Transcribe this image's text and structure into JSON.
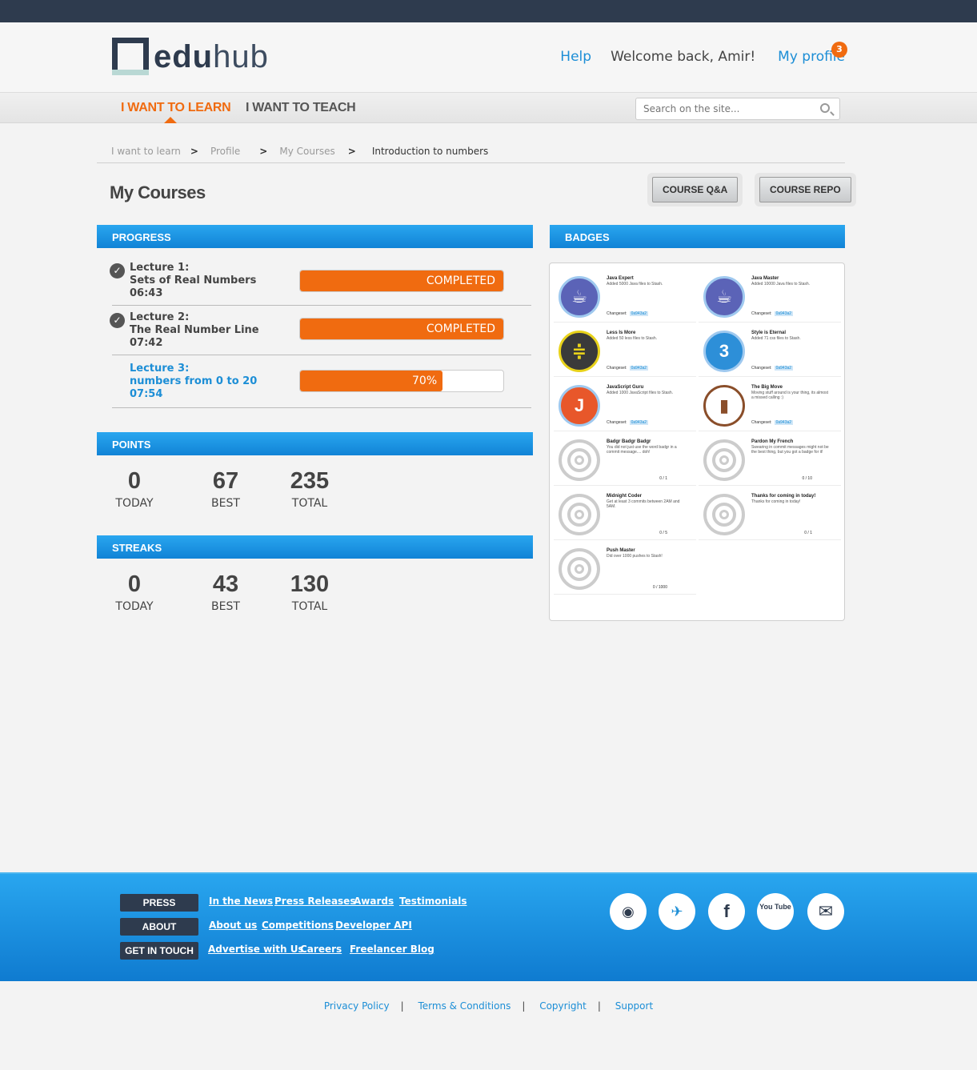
{
  "logo": {
    "bold": "edu",
    "light": "hub"
  },
  "header": {
    "help": "Help",
    "welcome": "Welcome back, Amir!",
    "profile": "My profile",
    "notifications": "3"
  },
  "nav": {
    "learn": "I WANT TO LEARN",
    "teach": "I WANT TO TEACH"
  },
  "search": {
    "placeholder": "Search on the site..."
  },
  "breadcrumb": [
    "I want to learn",
    "Profile",
    "My Courses",
    "Introduction to numbers"
  ],
  "page_title": "My Courses",
  "buttons": {
    "qa": "COURSE Q&A",
    "repo": "COURSE REPO"
  },
  "progress": {
    "title": "PROGRESS",
    "lectures": [
      {
        "line1": "Lecture 1:",
        "line2": "Sets of Real Numbers",
        "line3": "06:43",
        "status": "COMPLETED",
        "percent": 100
      },
      {
        "line1": "Lecture 2:",
        "line2": "The Real Number Line",
        "line3": "07:42",
        "status": "COMPLETED",
        "percent": 100
      },
      {
        "line1": "Lecture 3:",
        "line2": "numbers from 0 to 20",
        "line3": "07:54",
        "status": "70%",
        "percent": 70
      }
    ]
  },
  "points": {
    "title": "POINTS",
    "today": "0",
    "best": "67",
    "total": "235",
    "today_label": "TODAY",
    "best_label": "BEST",
    "total_label": "TOTAL"
  },
  "streaks": {
    "title": "STREAKS",
    "today": "0",
    "best": "43",
    "total": "130",
    "today_label": "TODAY",
    "best_label": "BEST",
    "total_label": "TOTAL"
  },
  "badges": {
    "title": "BADGES",
    "changeset_label": "Changeset:",
    "changeset_value": "0a943a2",
    "items": [
      {
        "name": "Java Expert",
        "desc": "Added 5000 Java files to Stash.",
        "earned": true,
        "color": "#5b63b7",
        "icon": "coffee-cup-icon",
        "glyph": "☕"
      },
      {
        "name": "Java Master",
        "desc": "Added 10000 Java files to Stash.",
        "earned": true,
        "color": "#5b63b7",
        "icon": "coffee-cup-icon",
        "glyph": "☕"
      },
      {
        "name": "Less Is More",
        "desc": "Added 50 less files to Stash.",
        "earned": true,
        "color": "#3a3a3a",
        "icon": "less-icon",
        "glyph": "≑"
      },
      {
        "name": "Style is Eternal",
        "desc": "Added 71 css files to Stash.",
        "earned": true,
        "color": "#2d8fd8",
        "icon": "css3-icon",
        "glyph": "3"
      },
      {
        "name": "JavaScript Guru",
        "desc": "Added 1000 JavaScript files to Stash.",
        "earned": true,
        "color": "#e8572a",
        "icon": "javascript-icon",
        "glyph": "J"
      },
      {
        "name": "The Big Move",
        "desc": "Moving stuff around is your thing, its almost a missed calling :)",
        "earned": true,
        "color": "#ffffff",
        "icon": "hand-truck-icon",
        "glyph": "▮"
      },
      {
        "name": "Badgr Badgr Badgr",
        "desc": "You did not just use the word badgr in a commit message.... doh!",
        "earned": false,
        "count": "0 / 1",
        "icon": "target-icon"
      },
      {
        "name": "Pardon My French",
        "desc": "Swearing in commit messages might not be the best thing, but you got a badge for it!",
        "earned": false,
        "count": "0 / 10",
        "icon": "target-icon"
      },
      {
        "name": "Midnight Coder",
        "desc": "Get at least 3 commits between 2AM and 5AM.",
        "earned": false,
        "count": "0 / 5",
        "icon": "target-icon"
      },
      {
        "name": "Thanks for coming in today!",
        "desc": "Thanks for coming in today!",
        "earned": false,
        "count": "0 / 1",
        "icon": "target-icon"
      },
      {
        "name": "Push Master",
        "desc": "Did over 1000 pushes to Stash!",
        "earned": false,
        "count": "0 / 1000",
        "icon": "target-icon"
      }
    ]
  },
  "footer": {
    "tags": {
      "press": "PRESS",
      "about": "ABOUT",
      "contact": "GET IN TOUCH"
    },
    "press_links": [
      "In the News",
      "Press Releases",
      "Awards",
      "Testimonials"
    ],
    "about_links": [
      "About us",
      "Competitions",
      "Developer API"
    ],
    "contact_links": [
      "Advertise with Us",
      "Careers",
      "Freelancer Blog"
    ],
    "social": [
      {
        "name": "rss-icon",
        "glyph": "◉"
      },
      {
        "name": "twitter-icon",
        "glyph": "✈"
      },
      {
        "name": "facebook-icon",
        "glyph": "f"
      },
      {
        "name": "youtube-icon",
        "glyph": "You Tube"
      },
      {
        "name": "mail-icon",
        "glyph": "✉"
      }
    ],
    "legal": [
      "Privacy Policy",
      "Terms & Conditions",
      "Copyright",
      "Support"
    ]
  }
}
